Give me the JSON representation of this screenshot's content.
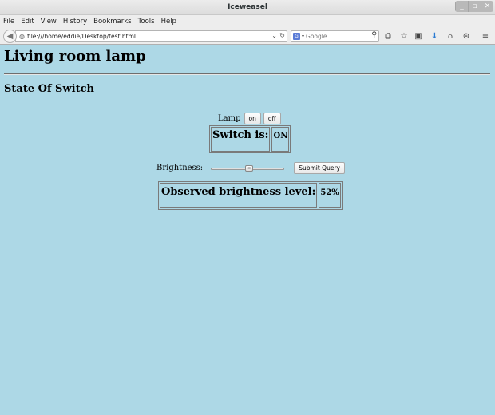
{
  "window": {
    "title": "Iceweasel",
    "controls": [
      "_",
      "▫",
      "✕"
    ]
  },
  "menu": [
    "File",
    "Edit",
    "View",
    "History",
    "Bookmarks",
    "Tools",
    "Help"
  ],
  "nav": {
    "url": "file:///home/eddie/Desktop/test.html",
    "search_placeholder": "Google",
    "search_engine_letter": "G"
  },
  "page": {
    "heading": "Living room lamp",
    "subheading": "State Of Switch",
    "lamp_label": "Lamp",
    "on_label": "on",
    "off_label": "off",
    "switch_label": "Switch is:",
    "switch_value": "ON",
    "brightness_label": "Brightness:",
    "brightness_value": 0.52,
    "submit_label": "Submit Query",
    "observed_label": "Observed brightness level:",
    "observed_value": "52%"
  }
}
